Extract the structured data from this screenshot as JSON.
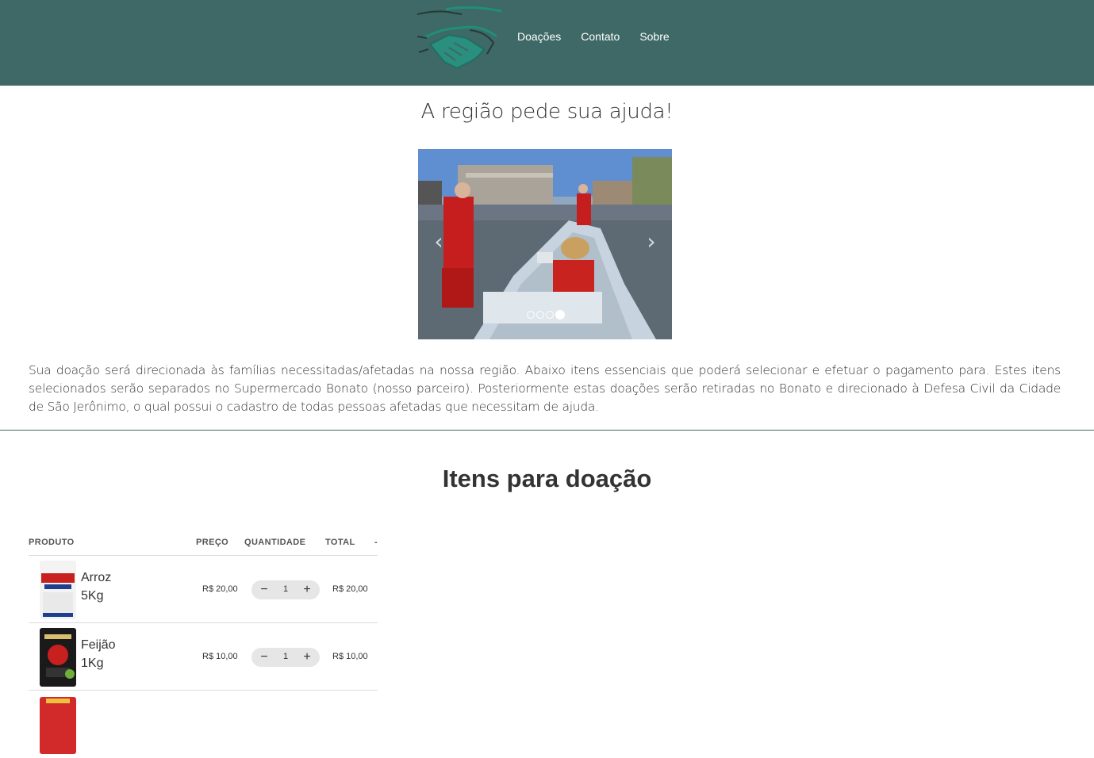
{
  "header": {
    "nav": [
      {
        "label": "Doações"
      },
      {
        "label": "Contato"
      },
      {
        "label": "Sobre"
      }
    ]
  },
  "hero": {
    "title": "A região pede sua ajuda!",
    "carousel": {
      "slide_count": 4,
      "active_slide": 4,
      "prev_icon": "chevron-left-icon",
      "next_icon": "chevron-right-icon"
    }
  },
  "description": "Sua doação será direcionada às famílias necessitadas/afetadas na nossa região. Abaixo itens essenciais que poderá selecionar e efetuar o pagamento para. Estes itens selecionados serão separados no Supermercado Bonato (nosso parceiro). Posteriormente estas doações serão retiradas no Bonato e direcionado à Defesa Civil da Cidade de São Jerônimo, o qual possui o cadastro de todas pessoas afetadas que necessitam de ajuda.",
  "donations": {
    "title": "Itens para doação",
    "columns": {
      "product": "PRODUTO",
      "price": "PREÇO",
      "quantity": "QUANTIDADE",
      "total": "TOTAL",
      "action": "-"
    },
    "items": [
      {
        "name_line1": "Arroz",
        "name_line2": "5Kg",
        "price": "R$ 20,00",
        "quantity": "1",
        "total": "R$ 20,00"
      },
      {
        "name_line1": "Feijão",
        "name_line2": "1Kg",
        "price": "R$ 10,00",
        "quantity": "1",
        "total": "R$ 10,00"
      }
    ]
  },
  "colors": {
    "header_bg": "#3e6966",
    "logo_accent": "#1f8f7a",
    "divider": "#3e6966"
  }
}
